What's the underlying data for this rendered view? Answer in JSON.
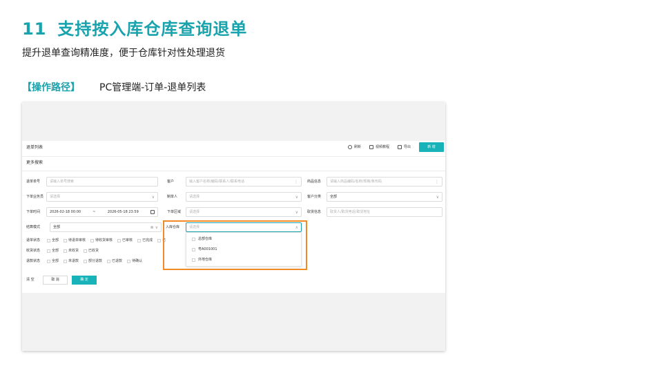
{
  "slide": {
    "number": "11",
    "title": "支持按入库仓库查询退单",
    "subtitle": "提升退单查询精准度，便于仓库针对性处理退货",
    "path_label": "【操作路径】",
    "path_value": "PC管理端-订单-退单列表"
  },
  "app": {
    "page_title": "退单列表",
    "toolbar": {
      "refresh": "刷新",
      "video": "视频教程",
      "export": "导出",
      "new": "新 增"
    },
    "more_search": "更多搜索",
    "fields": {
      "return_no": {
        "label": "退单单号",
        "placeholder": "请输入单号搜索"
      },
      "customer": {
        "label": "客户",
        "placeholder": "输入客户名称/编码/联系人/联系电话"
      },
      "product": {
        "label": "商品信息",
        "placeholder": "请输入商品编码/名称/规格/条形码"
      },
      "salesperson": {
        "label": "下单业务员",
        "placeholder": "请选择"
      },
      "creator": {
        "label": "制单人",
        "placeholder": "请选择"
      },
      "customer_cat": {
        "label": "客户分类",
        "value": "全部"
      },
      "order_time": {
        "label": "下单时间",
        "start": "2026-02-18 00:00",
        "sep": "~",
        "end": "2026-05-18 23:59"
      },
      "region": {
        "label": "下单区域",
        "placeholder": "请选择"
      },
      "pickup": {
        "label": "取货信息",
        "placeholder": "取货人/取货电话/取货地址"
      },
      "settle": {
        "label": "结算模式",
        "value": "全部"
      },
      "warehouse": {
        "label": "入库仓库",
        "placeholder": "请选择"
      }
    },
    "status_rows": [
      {
        "label": "退单状态",
        "options": [
          "全部",
          "待退单审核",
          "待收货审核",
          "已审核",
          "已完成",
          "已"
        ]
      },
      {
        "label": "收货状态",
        "options": [
          "全部",
          "未收货",
          "已收货"
        ]
      },
      {
        "label": "退款状态",
        "options": [
          "全部",
          "未退款",
          "部分退款",
          "已退款",
          "待确认"
        ]
      }
    ],
    "warehouse_options": [
      "总部仓库",
      "粤A001001",
      "外地仓库"
    ],
    "buttons": {
      "clear": "清 空",
      "cancel": "取 消",
      "ok": "确 定"
    }
  },
  "colors": {
    "accent": "#19a3ad",
    "button": "#17b3b8",
    "highlight": "#f08a24"
  }
}
